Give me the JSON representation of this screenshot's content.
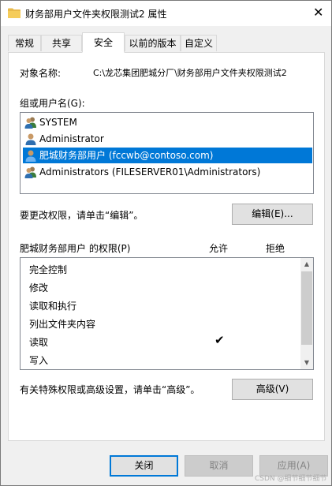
{
  "window": {
    "title": "财务部用户文件夹权限测试2 属性",
    "close_glyph": "✕"
  },
  "tabs": [
    {
      "label": "常规",
      "active": false
    },
    {
      "label": "共享",
      "active": false
    },
    {
      "label": "安全",
      "active": true
    },
    {
      "label": "以前的版本",
      "active": false
    },
    {
      "label": "自定义",
      "active": false
    }
  ],
  "security": {
    "object_name_label": "对象名称:",
    "object_name_value": "C:\\龙芯集团肥城分厂\\财务部用户文件夹权限测试2",
    "groups_label": "组或用户名(G):",
    "users": [
      {
        "label": "SYSTEM",
        "icon": "group-user-icon",
        "selected": false
      },
      {
        "label": "Administrator",
        "icon": "user-icon",
        "selected": false
      },
      {
        "label": "肥城财务部用户 (fccwb@contoso.com)",
        "icon": "user-icon",
        "selected": true
      },
      {
        "label": "Administrators (FILESERVER01\\Administrators)",
        "icon": "group-user-icon",
        "selected": false
      }
    ],
    "edit_hint": "要更改权限，请单击“编辑”。",
    "edit_button": "编辑(E)...",
    "permissions_label": "肥城财务部用户 的权限(P)",
    "allow_header": "允许",
    "deny_header": "拒绝",
    "permissions": [
      {
        "name": "完全控制",
        "allow": false,
        "deny": false
      },
      {
        "name": "修改",
        "allow": false,
        "deny": false
      },
      {
        "name": "读取和执行",
        "allow": false,
        "deny": false
      },
      {
        "name": "列出文件夹内容",
        "allow": false,
        "deny": false
      },
      {
        "name": "读取",
        "allow": true,
        "deny": false
      },
      {
        "name": "写入",
        "allow": false,
        "deny": false
      }
    ],
    "check_glyph": "✔",
    "advanced_hint": "有关特殊权限或高级设置，请单击“高级”。",
    "advanced_button": "高级(V)"
  },
  "footer": {
    "close": "关闭",
    "cancel": "取消",
    "apply": "应用(A)"
  },
  "watermark": "CSDN @细节细节细节",
  "colors": {
    "selection": "#0078d7",
    "folder": "#e8b94a"
  }
}
